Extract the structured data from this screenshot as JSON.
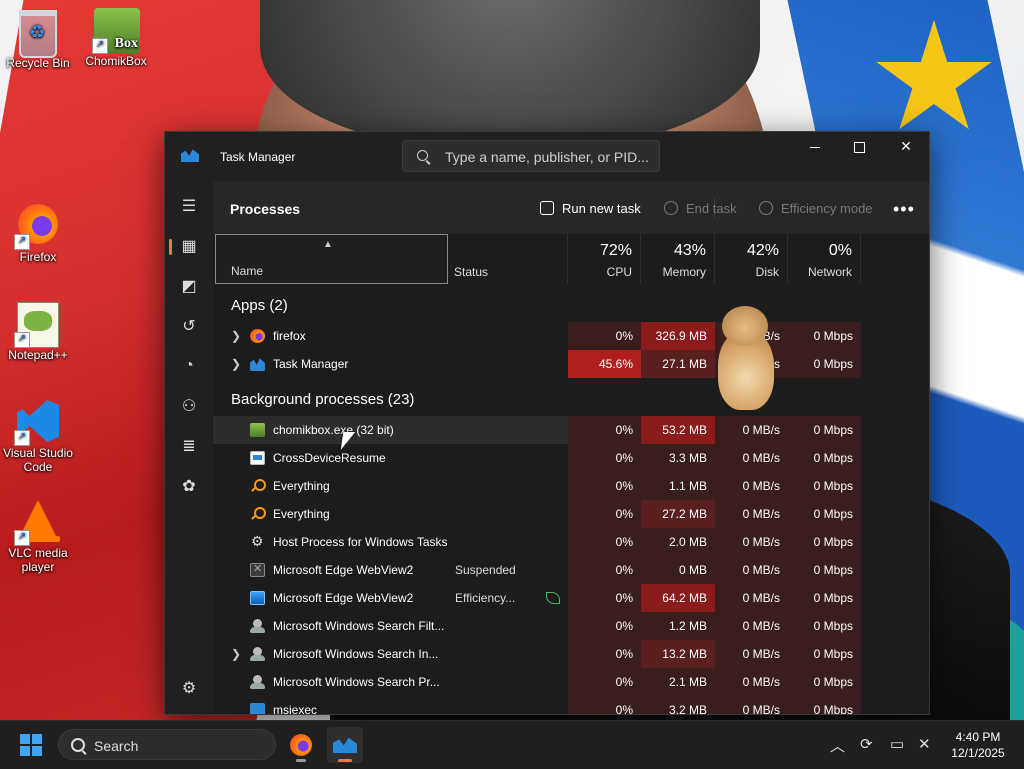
{
  "desktop": {
    "icons": [
      {
        "label": "Recycle Bin"
      },
      {
        "label": "ChomikBox"
      },
      {
        "label": "Firefox"
      },
      {
        "label": "Notepad++"
      },
      {
        "label": "Visual Studio Code"
      },
      {
        "label": "VLC media player"
      }
    ],
    "chomikbox_icon_text": "Box"
  },
  "window": {
    "title": "Task Manager",
    "search_placeholder": "Type a name, publisher, or PID..."
  },
  "commandbar": {
    "heading": "Processes",
    "run_new_task": "Run new task",
    "end_task": "End task",
    "efficiency_mode": "Efficiency mode"
  },
  "columns": {
    "name": "Name",
    "status": "Status",
    "cpu": {
      "label": "CPU",
      "pct": "72%"
    },
    "memory": {
      "label": "Memory",
      "pct": "43%"
    },
    "disk": {
      "label": "Disk",
      "pct": "42%"
    },
    "network": {
      "label": "Network",
      "pct": "0%"
    }
  },
  "sections": {
    "apps": "Apps (2)",
    "background": "Background processes (23)"
  },
  "apps": [
    {
      "name": "firefox",
      "status": "",
      "cpu": "0%",
      "memory": "326.9 MB",
      "disk": "0 MB/s",
      "network": "0 Mbps",
      "icon": "firefox-icon"
    },
    {
      "name": "Task Manager",
      "status": "",
      "cpu": "45.6%",
      "memory": "27.1 MB",
      "disk": "0 MB/s",
      "network": "0 Mbps",
      "icon": "task-manager-icon"
    }
  ],
  "background": [
    {
      "name": "chomikbox.exe (32 bit)",
      "status": "",
      "cpu": "0%",
      "memory": "53.2 MB",
      "disk": "0 MB/s",
      "network": "0 Mbps",
      "icon": "chomikbox-icon"
    },
    {
      "name": "CrossDeviceResume",
      "status": "",
      "cpu": "0%",
      "memory": "3.3 MB",
      "disk": "0 MB/s",
      "network": "0 Mbps",
      "icon": "window-icon"
    },
    {
      "name": "Everything",
      "status": "",
      "cpu": "0%",
      "memory": "1.1 MB",
      "disk": "0 MB/s",
      "network": "0 Mbps",
      "icon": "everything-search-icon"
    },
    {
      "name": "Everything",
      "status": "",
      "cpu": "0%",
      "memory": "27.2 MB",
      "disk": "0 MB/s",
      "network": "0 Mbps",
      "icon": "everything-search-icon"
    },
    {
      "name": "Host Process for Windows Tasks",
      "status": "",
      "cpu": "0%",
      "memory": "2.0 MB",
      "disk": "0 MB/s",
      "network": "0 Mbps",
      "icon": "gear-icon"
    },
    {
      "name": "Microsoft Edge WebView2",
      "status": "Suspended",
      "cpu": "0%",
      "memory": "0 MB",
      "disk": "0 MB/s",
      "network": "0 Mbps",
      "icon": "webview-suspended-icon"
    },
    {
      "name": "Microsoft Edge WebView2",
      "status": "Efficiency...",
      "cpu": "0%",
      "memory": "64.2 MB",
      "disk": "0 MB/s",
      "network": "0 Mbps",
      "icon": "webview-icon"
    },
    {
      "name": "Microsoft Windows Search Filt...",
      "status": "",
      "cpu": "0%",
      "memory": "1.2 MB",
      "disk": "0 MB/s",
      "network": "0 Mbps",
      "icon": "search-indexer-icon"
    },
    {
      "name": "Microsoft Windows Search In...",
      "status": "",
      "cpu": "0%",
      "memory": "13.2 MB",
      "disk": "0 MB/s",
      "network": "0 Mbps",
      "icon": "search-indexer-icon"
    },
    {
      "name": "Microsoft Windows Search Pr...",
      "status": "",
      "cpu": "0%",
      "memory": "2.1 MB",
      "disk": "0 MB/s",
      "network": "0 Mbps",
      "icon": "search-indexer-icon"
    },
    {
      "name": "msiexec",
      "status": "",
      "cpu": "0%",
      "memory": "3.2 MB",
      "disk": "0 MB/s",
      "network": "0 Mbps",
      "icon": "installer-icon"
    }
  ],
  "heat_colors": {
    "low": "#3a1d1d",
    "medium": "#5a2020",
    "high": "#8a1c1c",
    "max": "#b01e1e"
  },
  "taskbar": {
    "search_label": "Search",
    "clock_time": "4:40 PM",
    "clock_date": "12/1/2025"
  }
}
